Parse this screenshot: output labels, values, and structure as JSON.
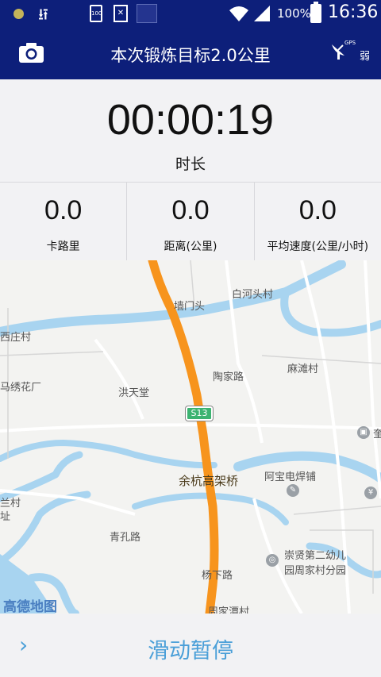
{
  "status_bar": {
    "battery_percent": "100%",
    "time": "16:36",
    "small_battery_label": "100"
  },
  "header": {
    "title": "本次锻炼目标2.0公里",
    "gps_label": "GPS",
    "gps_strength": "弱"
  },
  "timer": {
    "value": "00:00:19",
    "label": "时长"
  },
  "stats": [
    {
      "value": "0.0",
      "label": "卡路里"
    },
    {
      "value": "0.0",
      "label": "距离(公里)"
    },
    {
      "value": "0.0",
      "label": "平均速度(公里/小时)"
    }
  ],
  "map": {
    "places": {
      "baihetou": "白河头村",
      "qiangmentou": "墙门头",
      "xizhuang": "西庄村",
      "mazhuang": "马绣花厂",
      "hongtiantang": "洪天堂",
      "taojialu": "陶家路",
      "matan": "麻滩村",
      "yuhang": "余杭高架桥",
      "abao": "阿宝电焊铺",
      "lancun": "兰村",
      "zhi": "址",
      "qingkong": "青孔路",
      "chongxian": "崇贤第二幼儿",
      "chongxian2": "园周家村分园",
      "yangxia": "杨下路",
      "zhoujiatan": "周家潭村",
      "right_edge": "奎"
    },
    "road_shield": "S13",
    "logo": "高德地图",
    "colors": {
      "route": "#f7941d",
      "water": "#a8d4f0"
    }
  },
  "bottom": {
    "slide_label": "滑动暂停"
  }
}
